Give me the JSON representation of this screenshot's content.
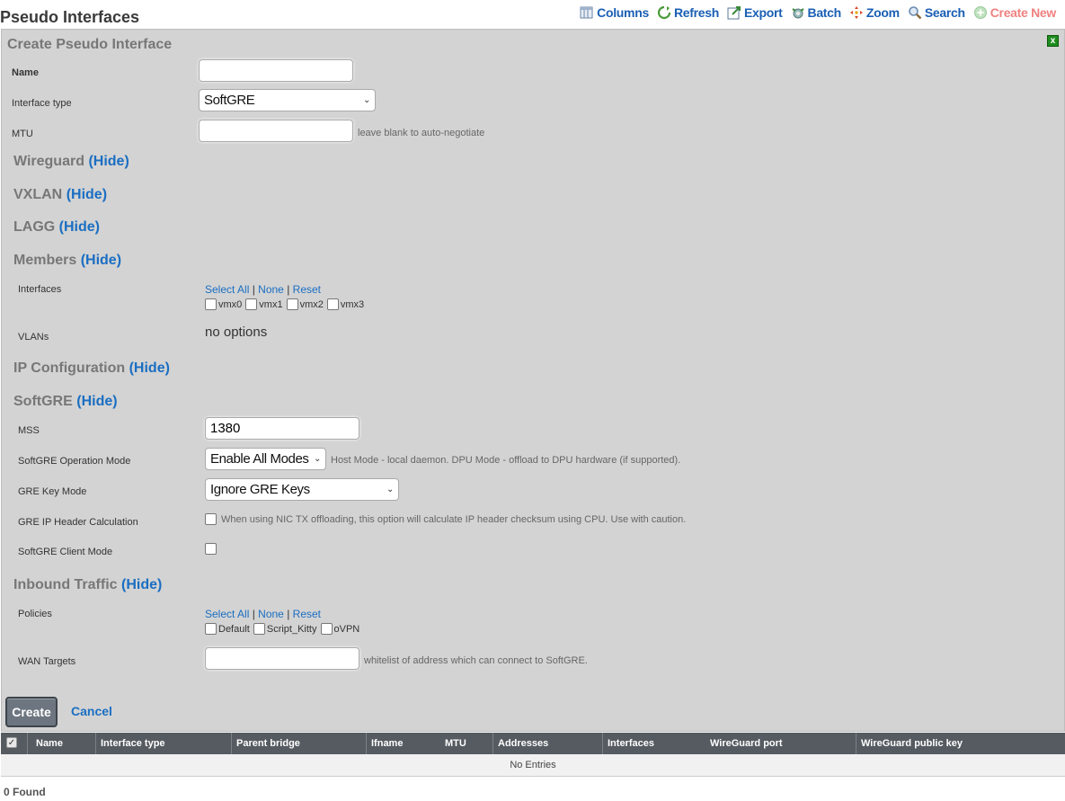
{
  "page": {
    "title": "Pseudo Interfaces"
  },
  "toolbar": {
    "items": [
      {
        "label": "Columns",
        "icon": "columns-icon",
        "enabled": true
      },
      {
        "label": "Refresh",
        "icon": "refresh-icon",
        "enabled": true
      },
      {
        "label": "Export",
        "icon": "export-icon",
        "enabled": true
      },
      {
        "label": "Batch",
        "icon": "batch-icon",
        "enabled": true
      },
      {
        "label": "Zoom",
        "icon": "zoom-icon",
        "enabled": true
      },
      {
        "label": "Search",
        "icon": "search-icon",
        "enabled": true
      },
      {
        "label": "Create New",
        "icon": "create-new-icon",
        "enabled": false
      }
    ]
  },
  "form": {
    "title": "Create Pseudo Interface",
    "close_label": "x",
    "name": {
      "label": "Name",
      "value": ""
    },
    "interface_type": {
      "label": "Interface type",
      "value": "SoftGRE"
    },
    "mtu": {
      "label": "MTU",
      "value": "",
      "hint": "leave blank to auto-negotiate"
    },
    "sections": {
      "wireguard": {
        "title": "Wireguard",
        "toggle": "(Hide)"
      },
      "vxlan": {
        "title": "VXLAN",
        "toggle": "(Hide)"
      },
      "lagg": {
        "title": "LAGG",
        "toggle": "(Hide)"
      },
      "members": {
        "title": "Members",
        "toggle": "(Hide)"
      },
      "ip_config": {
        "title": "IP Configuration",
        "toggle": "(Hide)"
      },
      "softgre": {
        "title": "SoftGRE",
        "toggle": "(Hide)"
      },
      "inbound": {
        "title": "Inbound Traffic",
        "toggle": "(Hide)"
      }
    },
    "members": {
      "interfaces_label": "Interfaces",
      "select_all": "Select All",
      "none": "None",
      "reset": "Reset",
      "sep": "|",
      "interfaces": [
        "vmx0",
        "vmx1",
        "vmx2",
        "vmx3"
      ],
      "vlans_label": "VLANs",
      "vlans_value": "no options"
    },
    "softgre": {
      "mss": {
        "label": "MSS",
        "value": "1380"
      },
      "operation_mode": {
        "label": "SoftGRE Operation Mode",
        "value": "Enable All Modes",
        "hint": "Host Mode - local daemon. DPU Mode - offload to DPU hardware (if supported)."
      },
      "key_mode": {
        "label": "GRE Key Mode",
        "value": "Ignore GRE Keys"
      },
      "ip_header": {
        "label": "GRE IP Header Calculation",
        "checked": false,
        "hint": "When using NIC TX offloading, this option will calculate IP header checksum using CPU. Use with caution."
      },
      "client_mode": {
        "label": "SoftGRE Client Mode",
        "checked": false
      }
    },
    "inbound": {
      "policies_label": "Policies",
      "select_all": "Select All",
      "none": "None",
      "reset": "Reset",
      "sep": "|",
      "policies": [
        "Default",
        "Script_Kitty",
        "oVPN"
      ],
      "wan_label": "WAN Targets",
      "wan_value": "",
      "wan_hint": "whitelist of address which can connect to SoftGRE."
    },
    "create_label": "Create",
    "cancel_label": "Cancel"
  },
  "grid": {
    "columns": [
      "Name",
      "Interface type",
      "Parent bridge",
      "Ifname",
      "MTU",
      "Addresses",
      "Interfaces",
      "WireGuard port",
      "WireGuard public key"
    ],
    "select_all_mark": "✓",
    "empty_text": "No Entries",
    "found_text": "0 Found"
  },
  "colors": {
    "accent": "#1a6ec2",
    "panel": "#d3d3d3",
    "grid_header": "#555b61",
    "disabled": "#f08080"
  }
}
